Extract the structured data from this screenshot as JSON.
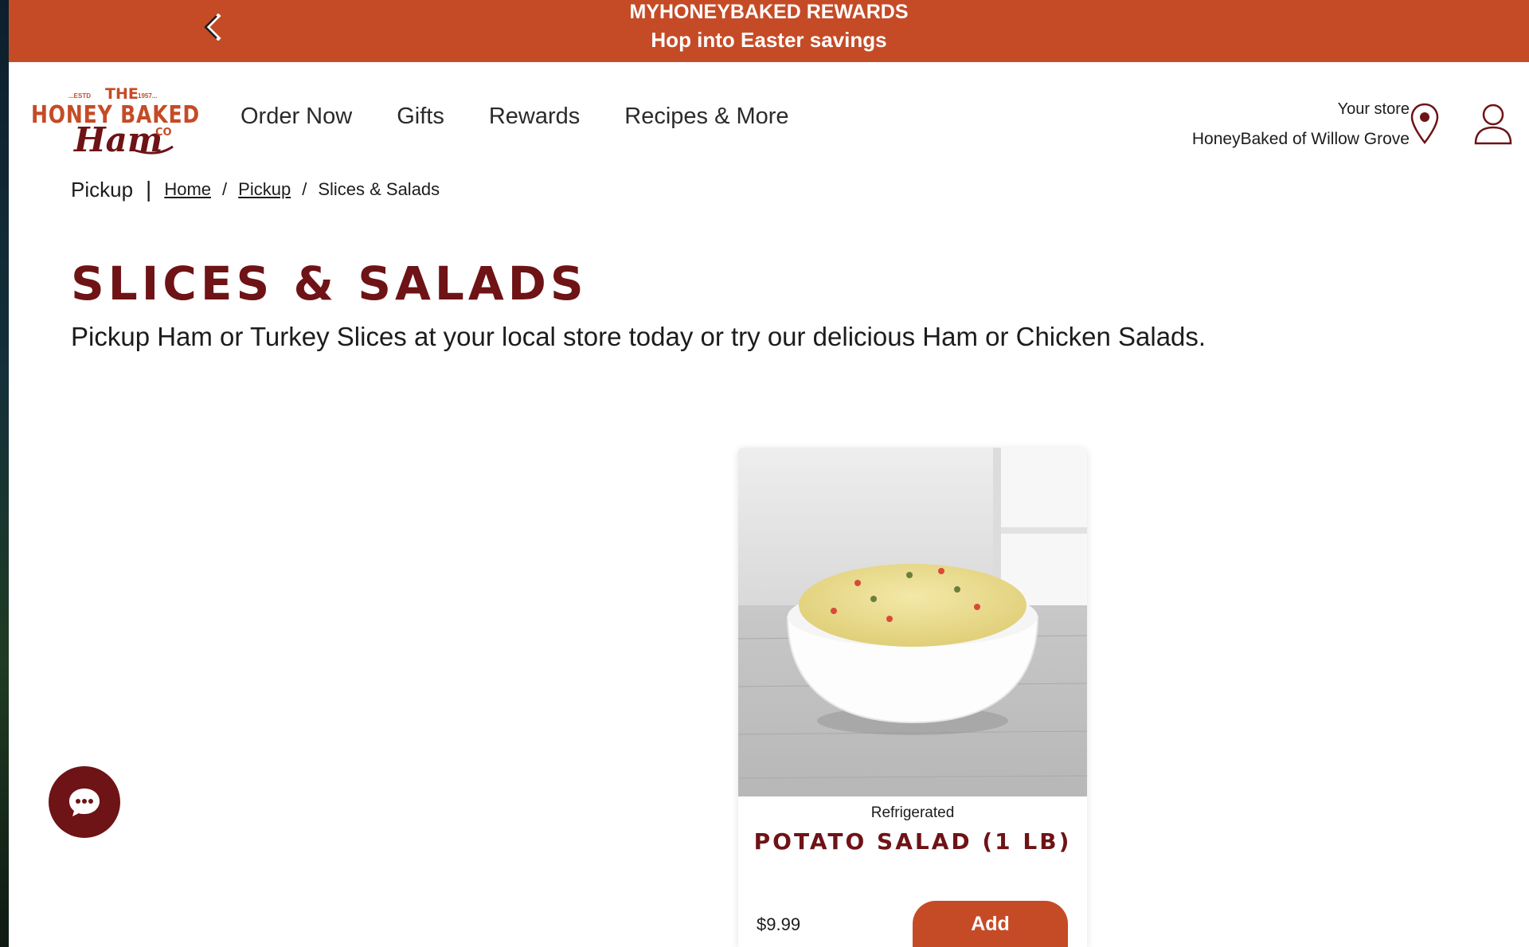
{
  "promo": {
    "line1": "MYHONEYBAKED REWARDS",
    "line2": "Hop into Easter savings"
  },
  "logo": {
    "estd": "...ESTD",
    "the": "THE",
    "year": "1957...",
    "brand": "HONEY BAKED",
    "ham": "Ham",
    "co": "CO"
  },
  "nav": {
    "items": [
      "Order Now",
      "Gifts",
      "Rewards",
      "Recipes & More"
    ]
  },
  "store": {
    "label": "Your store",
    "name": "HoneyBaked of Willow Grove"
  },
  "breadcrumb": {
    "section": "Pickup",
    "links": [
      "Home",
      "Pickup"
    ],
    "current": "Slices & Salads"
  },
  "page": {
    "title": "SLICES & SALADS",
    "description": "Pickup Ham or Turkey Slices at your local store today or try our delicious Ham or Chicken Salads."
  },
  "product": {
    "category": "Refrigerated",
    "name": "POTATO SALAD (1 LB)",
    "price": "$9.99",
    "add_label": "Add"
  },
  "colors": {
    "brand_orange": "#c54b26",
    "brand_maroon": "#6e1316"
  },
  "icons": {
    "back": "chevron-left-icon",
    "store": "map-pin-icon",
    "account": "user-icon",
    "chat": "chat-bubble-icon"
  }
}
